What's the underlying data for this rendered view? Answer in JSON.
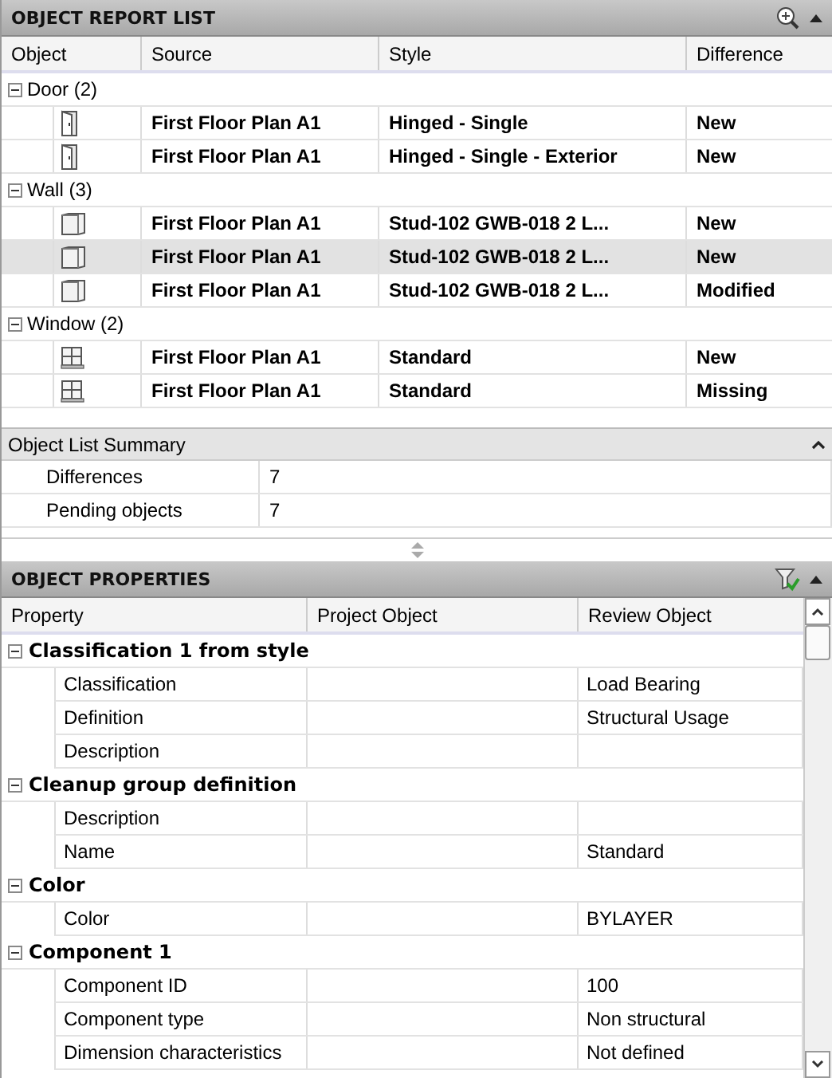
{
  "report": {
    "title": "OBJECT REPORT LIST",
    "columns": [
      "Object",
      "Source",
      "Style",
      "Difference"
    ],
    "groups": [
      {
        "label": "Door (2)",
        "expanded": true,
        "items": [
          {
            "kind": "door",
            "source": "First Floor Plan A1",
            "style": "Hinged - Single",
            "difference": "New",
            "selected": false
          },
          {
            "kind": "door",
            "source": "First Floor Plan A1",
            "style": "Hinged - Single - Exterior",
            "difference": "New",
            "selected": false
          }
        ]
      },
      {
        "label": "Wall (3)",
        "expanded": true,
        "items": [
          {
            "kind": "wall",
            "source": "First Floor Plan A1",
            "style": "Stud-102 GWB-018 2 L...",
            "difference": "New",
            "selected": false
          },
          {
            "kind": "wall",
            "source": "First Floor Plan A1",
            "style": "Stud-102 GWB-018 2 L...",
            "difference": "New",
            "selected": true
          },
          {
            "kind": "wall",
            "source": "First Floor Plan A1",
            "style": "Stud-102 GWB-018 2 L...",
            "difference": "Modified",
            "selected": false
          }
        ]
      },
      {
        "label": "Window (2)",
        "expanded": true,
        "items": [
          {
            "kind": "window",
            "source": "First Floor Plan A1",
            "style": "Standard",
            "difference": "New",
            "selected": false
          },
          {
            "kind": "window",
            "source": "First Floor Plan A1",
            "style": "Standard",
            "difference": "Missing",
            "selected": false
          }
        ]
      }
    ]
  },
  "summary": {
    "title": "Object List Summary",
    "expanded": true,
    "rows": [
      {
        "label": "Differences",
        "value": "7"
      },
      {
        "label": "Pending objects",
        "value": "7"
      }
    ]
  },
  "properties": {
    "title": "OBJECT PROPERTIES",
    "columns": [
      "Property",
      "Project Object",
      "Review Object"
    ],
    "categories": [
      {
        "label": "Classification 1 from style",
        "expanded": true,
        "rows": [
          {
            "property": "Classification",
            "review": "Load Bearing"
          },
          {
            "property": "Definition",
            "review": "Structural Usage"
          },
          {
            "property": "Description"
          }
        ]
      },
      {
        "label": "Cleanup group definition",
        "expanded": true,
        "rows": [
          {
            "property": "Description"
          },
          {
            "property": "Name",
            "review": "Standard"
          }
        ]
      },
      {
        "label": "Color",
        "expanded": true,
        "rows": [
          {
            "property": "Color",
            "review": "BYLAYER"
          }
        ]
      },
      {
        "label": "Component 1",
        "expanded": true,
        "rows": [
          {
            "property": "Component ID",
            "review": "100"
          },
          {
            "property": "Component type",
            "review": "Non structural"
          },
          {
            "property": "Dimension characteristics",
            "review": "Not defined"
          }
        ]
      }
    ]
  }
}
